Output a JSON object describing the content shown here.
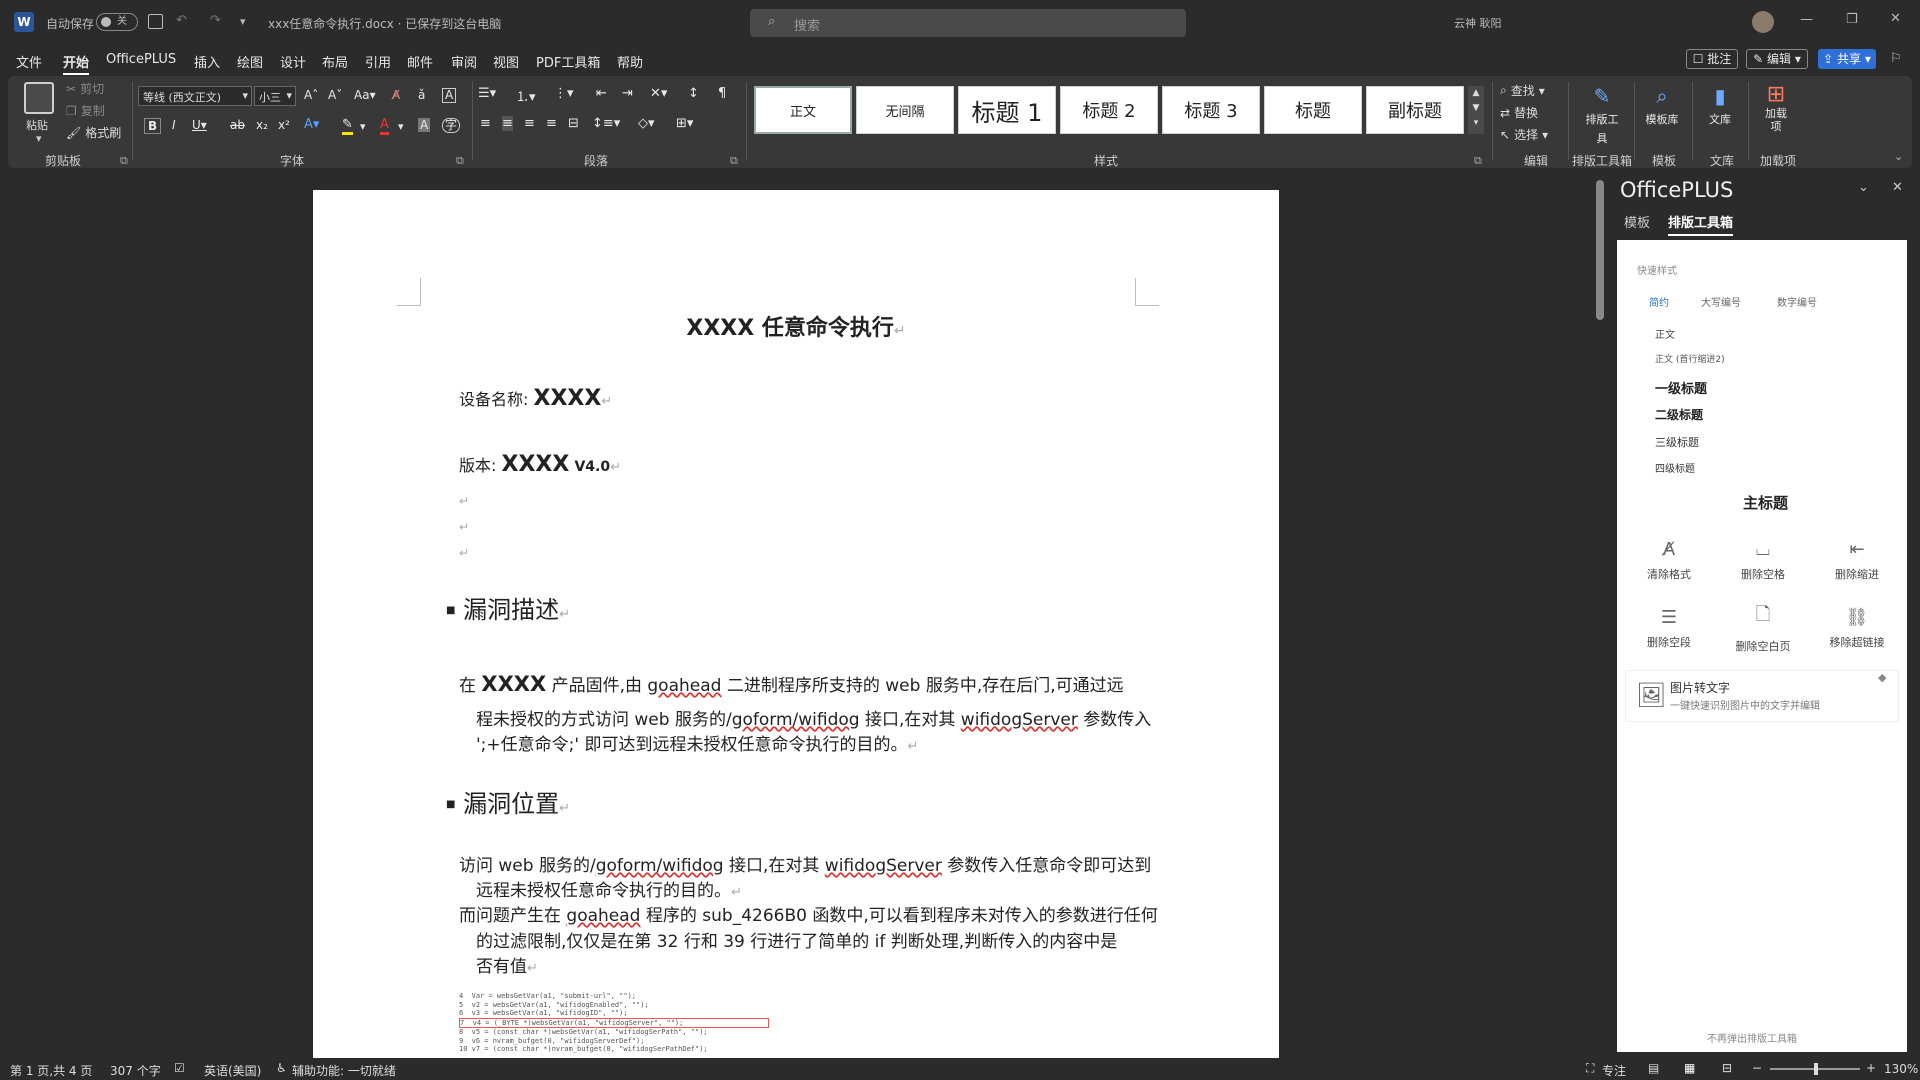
{
  "titlebar": {
    "autosave_label": "自动保存",
    "autosave_state": "关",
    "filename": "xxx任意命令执行.docx · 已保存到这台电脑",
    "search_placeholder": "搜索",
    "user": "云神 耿阳"
  },
  "menu": [
    "文件",
    "开始",
    "OfficePLUS",
    "插入",
    "绘图",
    "设计",
    "布局",
    "引用",
    "邮件",
    "审阅",
    "视图",
    "PDF工具箱",
    "帮助"
  ],
  "menu_right": {
    "comment": "批注",
    "edit": "编辑",
    "share": "共享"
  },
  "ribbon": {
    "clipboard": {
      "paste": "粘贴",
      "cut": "剪切",
      "copy": "复制",
      "format_painter": "格式刷",
      "label": "剪贴板"
    },
    "font": {
      "name": "等线 (西文正文)",
      "size": "小三",
      "label": "字体"
    },
    "paragraph": {
      "label": "段落"
    },
    "styles": {
      "items": [
        "正文",
        "无间隔",
        "标题 1",
        "标题 2",
        "标题 3",
        "标题",
        "副标题"
      ],
      "label": "样式"
    },
    "editing": {
      "find": "查找",
      "replace": "替换",
      "select": "选择",
      "label": "编辑"
    },
    "layout_tool": {
      "btn": "排版工具",
      "label": "排版工具箱"
    },
    "template": {
      "btn": "模板库",
      "label": "模板"
    },
    "library": {
      "btn": "文库",
      "label": "文库"
    },
    "addins": {
      "btn": "加载项",
      "label": "加载项"
    }
  },
  "doc": {
    "title": "XXXX 任意命令执行",
    "device_label": "设备名称:",
    "device_value": "XXXX",
    "version_label": "版本:",
    "version_value": "XXXX",
    "version_suffix": "V4.0",
    "h_desc": "漏洞描述",
    "desc_p1": "在",
    "desc_bold": "XXXX",
    "desc_p2": "产品固件,由",
    "goahead": "goahead",
    "desc_p3": "二进制程序所支持的 web 服务中,存在后门,可通过远",
    "desc_line2a": "程未授权的方式访问 web 服务的/",
    "goform": "goform/wifidog",
    "desc_line2b": "接口,在对其",
    "wifidogServer": "wifidogServer",
    "desc_line2c": "参数传入",
    "desc_line3": "';+任意命令;' 即可达到远程未授权任意命令执行的目的。",
    "h_loc": "漏洞位置",
    "loc_l1a": "访问 web 服务的/",
    "loc_l1b": "接口,在对其",
    "loc_l1c": "参数传入任意命令即可达到",
    "loc_l2": "远程未授权任意命令执行的目的。",
    "loc_l3a": "而问题产生在",
    "loc_l3b": "程序的 sub_4266B0 函数中,可以看到程序未对传入的参数进行任何",
    "loc_l4": "的过滤限制,仅仅是在第 32 行和 39 行进行了简单的 if 判断处理,判断传入的内容中是",
    "loc_l5": "否有值",
    "code": [
      "4  Var = websGetVar(a1, \"submit-url\", \"\");",
      "5  v2 = websGetVar(a1, \"wifidogEnabled\", \"\");",
      "6  v3 = websGetVar(a1, \"wifidogID\", \"\");",
      "7  v4 = (_BYTE *)websGetVar(a1, \"wifidogServer\", \"\");",
      "8  v5 = (const char *)websGetVar(a1, \"wifidogSerPath\", \"\");",
      "9  v6 = nvram_bufget(0, \"wifidogServerDef\");",
      "10 v7 = (const char *)nvram_bufget(0, \"wifidogSerPathDef\");"
    ]
  },
  "panel": {
    "title": "OfficePLUS",
    "tabs": [
      "模板",
      "排版工具箱"
    ],
    "quick_label": "快速样式",
    "subtabs": [
      "简约",
      "大写编号",
      "数字编号"
    ],
    "styles": [
      "正文",
      "正文 (首行缩进2)",
      "一级标题",
      "二级标题",
      "三级标题",
      "四级标题",
      "主标题"
    ],
    "tools": [
      "清除格式",
      "删除空格",
      "删除缩进",
      "删除空段",
      "删除空白页",
      "移除超链接"
    ],
    "ocr_title": "图片转文字",
    "ocr_desc": "一键快速识别图片中的文字并编辑",
    "footer": "不再弹出排版工具箱"
  },
  "status": {
    "page": "第 1 页,共 4 页",
    "words": "307 个字",
    "lang": "英语(美国)",
    "access": "辅助功能: 一切就绪",
    "focus": "专注",
    "zoom": "130%"
  },
  "colors": {
    "accent": "#1f6feb",
    "share_bg": "#2f6fd8"
  }
}
